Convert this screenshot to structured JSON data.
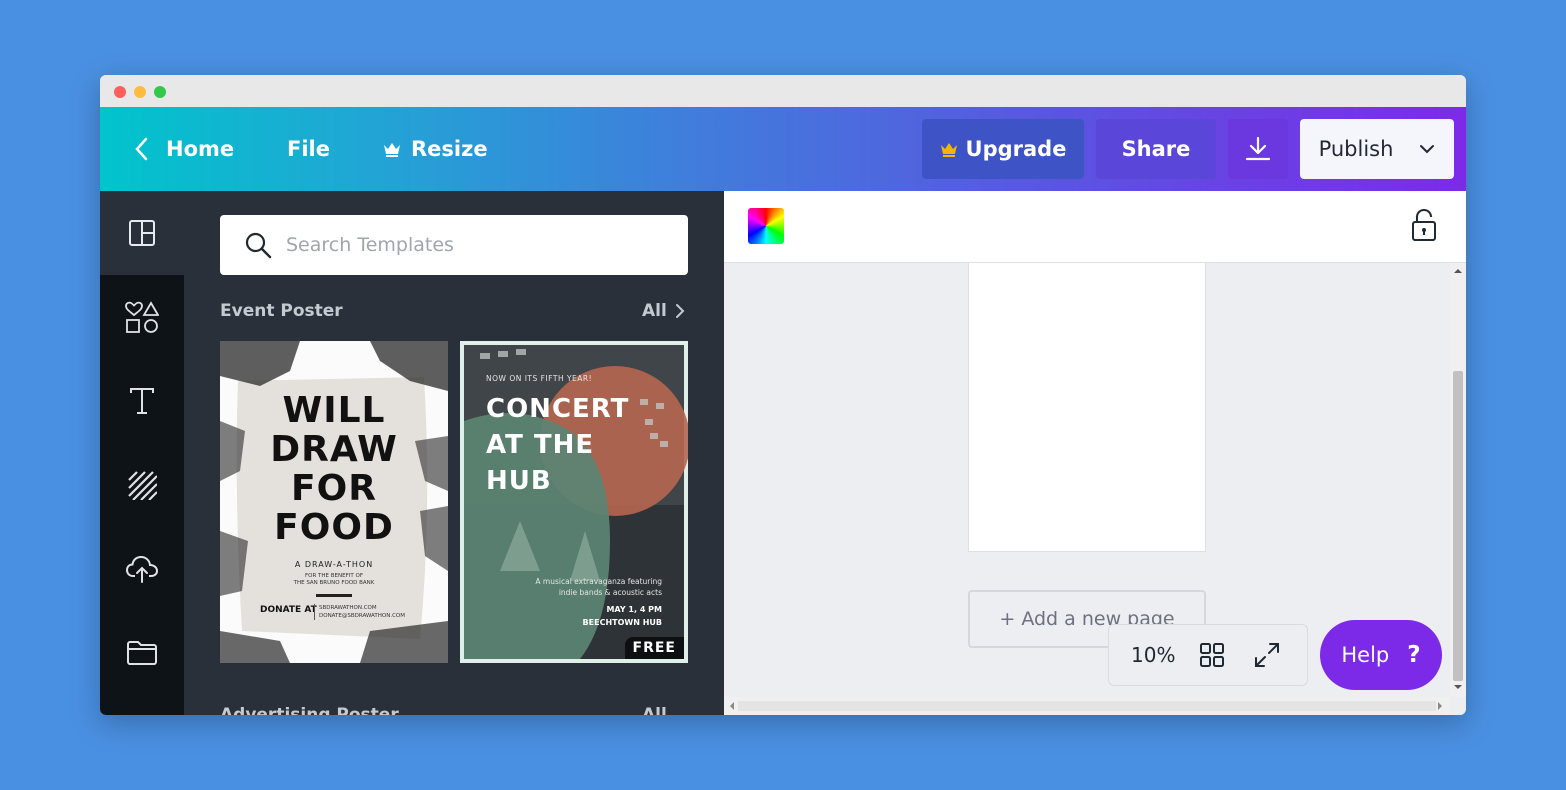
{
  "window": {
    "traffic_lights": {
      "close": "#fc605c",
      "minimize": "#fdbc40",
      "zoom": "#34c84a"
    }
  },
  "topbar": {
    "home_label": "Home",
    "file_label": "File",
    "resize_label": "Resize",
    "upgrade_label": "Upgrade",
    "share_label": "Share",
    "publish_label": "Publish",
    "icons": [
      "chevron-left-icon",
      "crown-icon",
      "download-icon",
      "chevron-down-icon"
    ]
  },
  "sidebar": {
    "items": [
      {
        "name": "templates",
        "icon": "layout-icon"
      },
      {
        "name": "elements",
        "icon": "shapes-icon"
      },
      {
        "name": "text",
        "icon": "text-icon"
      },
      {
        "name": "background",
        "icon": "pattern-icon"
      },
      {
        "name": "uploads",
        "icon": "cloud-upload-icon"
      },
      {
        "name": "folders",
        "icon": "folder-icon"
      }
    ]
  },
  "panel": {
    "search_placeholder": "Search Templates",
    "sections": [
      {
        "title": "Event Poster",
        "all_label": "All"
      },
      {
        "title": "Advertising Poster",
        "all_label": "All"
      }
    ],
    "templates": [
      {
        "headline": [
          "WILL",
          "DRAW",
          "FOR",
          "FOOD"
        ],
        "subtitle": "A DRAW-A-THON",
        "benefit": [
          "FOR THE BENEFIT OF",
          "THE SAN BRUNO FOOD BANK"
        ],
        "donate": "DONATE AT",
        "links": [
          "SBDRAWATHON.COM",
          "DONATE@SBDRAWATHON.COM"
        ]
      },
      {
        "kicker": "NOW ON ITS FIFTH YEAR!",
        "headline": [
          "CONCERT",
          "AT THE",
          "HUB"
        ],
        "desc": [
          "A musical extravaganza featuring",
          "indie bands & acoustic acts"
        ],
        "when": "MAY 1, 4 PM",
        "where": "BEECHTOWN HUB",
        "badge": "FREE"
      }
    ]
  },
  "canvas": {
    "add_page_label": "+ Add a new page",
    "zoom": "10%",
    "help_label": "Help",
    "help_glyph": "?"
  },
  "colors": {
    "accent_purple": "#7d2ae8",
    "accent_teal": "#00c4cc",
    "panel_bg": "#293039",
    "rail_bg": "#0e1318"
  }
}
